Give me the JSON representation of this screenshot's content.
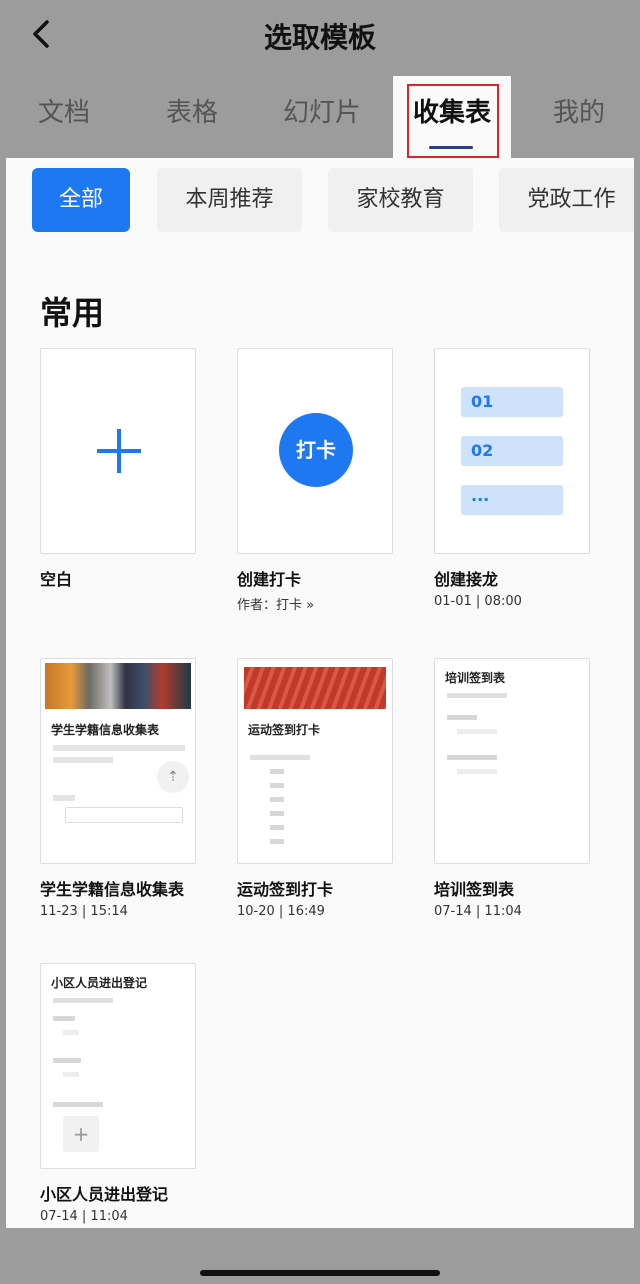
{
  "header": {
    "title": "选取模板"
  },
  "tabs": [
    {
      "label": "文档"
    },
    {
      "label": "表格"
    },
    {
      "label": "幻灯片"
    },
    {
      "label": "收集表"
    },
    {
      "label": "我的"
    }
  ],
  "chips": [
    {
      "label": "全部"
    },
    {
      "label": "本周推荐"
    },
    {
      "label": "家校教育"
    },
    {
      "label": "党政工作"
    }
  ],
  "section": {
    "title": "常用"
  },
  "templates": [
    {
      "name": "空白",
      "meta": ""
    },
    {
      "name": "创建打卡",
      "meta": "作者：打卡 »",
      "badge": "打卡"
    },
    {
      "name": "创建接龙",
      "meta": "01-01 | 08:00",
      "items": [
        "01",
        "02",
        "···"
      ]
    },
    {
      "name": "学生学籍信息收集表",
      "meta": "11-23 | 15:14"
    },
    {
      "name": "运动签到打卡",
      "meta": "10-20 | 16:49"
    },
    {
      "name": "培训签到表",
      "meta": "07-14 | 11:04"
    },
    {
      "name": "小区人员进出登记",
      "meta": "07-14 | 11:04"
    }
  ],
  "colors": {
    "accent": "#1d78f2",
    "highlight_box": "#d8262b",
    "tab_underline": "#2e3a8a"
  }
}
